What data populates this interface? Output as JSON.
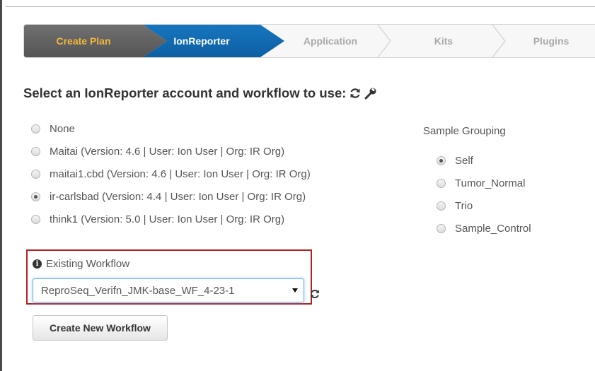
{
  "wizard": {
    "steps": [
      {
        "label": "Create Plan",
        "state": "done"
      },
      {
        "label": "IonReporter",
        "state": "active"
      },
      {
        "label": "Application",
        "state": "pending"
      },
      {
        "label": "Kits",
        "state": "pending"
      },
      {
        "label": "Plugins",
        "state": "pending"
      }
    ]
  },
  "section": {
    "title": "Select an IonReporter account and workflow to use:",
    "icons": [
      "refresh-icon",
      "wrench-icon"
    ]
  },
  "accounts": [
    {
      "label": "None",
      "checked": false
    },
    {
      "label": "Maitai (Version: 4.6 | User: Ion User | Org: IR Org)",
      "checked": false
    },
    {
      "label": "maitai1.cbd (Version: 4.6 | User: Ion User | Org: IR Org)",
      "checked": false
    },
    {
      "label": "ir-carlsbad (Version: 4.4 | User: Ion User | Org: IR Org)",
      "checked": true
    },
    {
      "label": "think1 (Version: 5.0 | User: Ion User | Org: IR Org)",
      "checked": false
    }
  ],
  "sample_grouping": {
    "title": "Sample Grouping",
    "options": [
      {
        "label": "Self",
        "checked": true
      },
      {
        "label": "Tumor_Normal",
        "checked": false
      },
      {
        "label": "Trio",
        "checked": false
      },
      {
        "label": "Sample_Control",
        "checked": false
      }
    ]
  },
  "workflow": {
    "label": "Existing Workflow",
    "selected": "ReproSeq_Verifn_JMK-base_WF_4-23-1"
  },
  "buttons": {
    "create_new": "Create New Workflow"
  },
  "colors": {
    "active_step": "#1676bf",
    "done_step": "#5f5f5f",
    "done_step_text": "#f5b73b",
    "highlight_border": "#b22222"
  }
}
